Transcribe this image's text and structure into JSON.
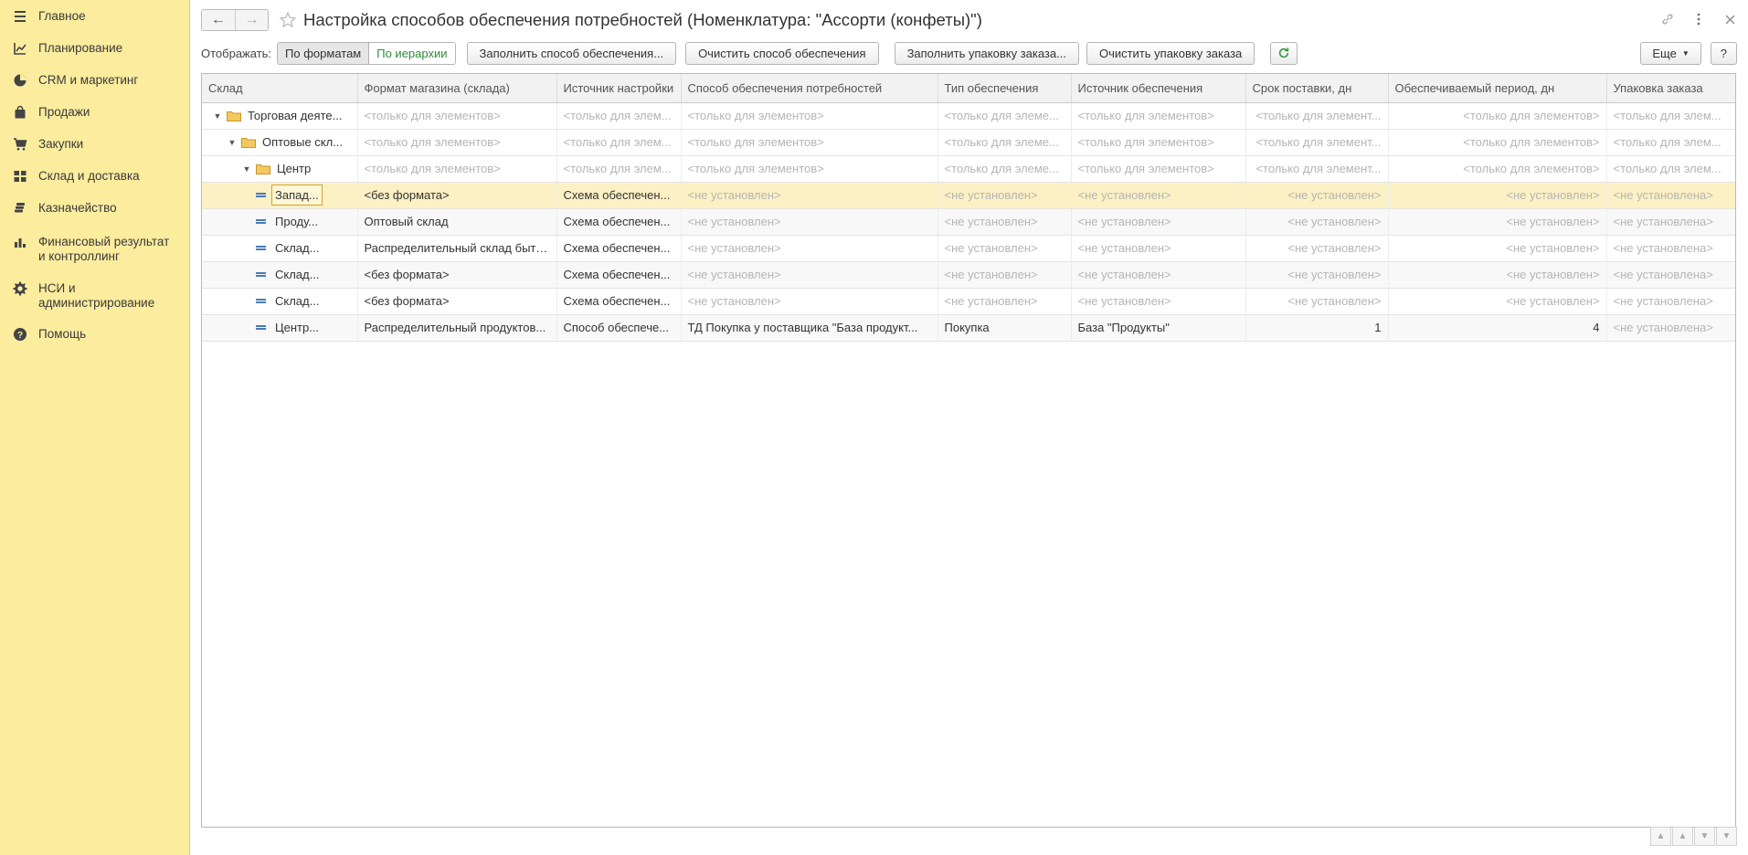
{
  "sidebar": {
    "items": [
      {
        "label": "Главное",
        "icon": "menu-icon"
      },
      {
        "label": "Планирование",
        "icon": "planning-icon"
      },
      {
        "label": "CRM и маркетинг",
        "icon": "pie-chart-icon"
      },
      {
        "label": "Продажи",
        "icon": "bag-icon"
      },
      {
        "label": "Закупки",
        "icon": "cart-icon"
      },
      {
        "label": "Склад и доставка",
        "icon": "warehouse-grid-icon"
      },
      {
        "label": "Казначейство",
        "icon": "coins-icon"
      },
      {
        "label": "Финансовый результат и контроллинг",
        "icon": "bar-chart-icon"
      },
      {
        "label": "НСИ и администрирование",
        "icon": "gear-icon"
      },
      {
        "label": "Помощь",
        "icon": "help-icon"
      }
    ]
  },
  "header": {
    "title": "Настройка способов обеспечения потребностей (Номенклатура: \"Ассорти (конфеты)\")"
  },
  "toolbar": {
    "display_label": "Отображать:",
    "by_formats": "По форматам",
    "by_hierarchy": "По иерархии",
    "fill_method": "Заполнить способ обеспечения...",
    "clear_method": "Очистить способ обеспечения",
    "fill_package": "Заполнить упаковку заказа...",
    "clear_package": "Очистить упаковку заказа",
    "more": "Еще",
    "help": "?"
  },
  "table": {
    "columns": [
      "Склад",
      "Формат магазина (склада)",
      "Источник настройки",
      "Способ обеспечения потребностей",
      "Тип обеспечения",
      "Источник обеспечения",
      "Срок поставки, дн",
      "Обеспечиваемый период, дн",
      "Упаковка заказа"
    ],
    "rows": [
      {
        "level": 0,
        "kind": "group",
        "cells": [
          "Торговая деяте...",
          "<только для элементов>",
          "<только для элем...",
          "<только для элементов>",
          "<только для элеме...",
          "<только для элементов>",
          "<только для элемент...",
          "<только для элементов>",
          "<только для элем..."
        ]
      },
      {
        "level": 1,
        "kind": "group",
        "cells": [
          "Оптовые скл...",
          "<только для элементов>",
          "<только для элем...",
          "<только для элементов>",
          "<только для элеме...",
          "<только для элементов>",
          "<только для элемент...",
          "<только для элементов>",
          "<только для элем..."
        ]
      },
      {
        "level": 2,
        "kind": "group",
        "cells": [
          "Центр",
          "<только для элементов>",
          "<только для элем...",
          "<только для элементов>",
          "<только для элеме...",
          "<только для элементов>",
          "<только для элемент...",
          "<только для элементов>",
          "<только для элем..."
        ]
      },
      {
        "level": 3,
        "kind": "item",
        "selected": true,
        "cells": [
          "Запад...",
          "<без формата>",
          "Схема обеспечен...",
          "<не установлен>",
          "<не установлен>",
          "<не установлен>",
          "<не установлен>",
          "<не установлен>",
          "<не установлена>"
        ]
      },
      {
        "level": 3,
        "kind": "item",
        "cells": [
          "Проду...",
          "Оптовый склад",
          "Схема обеспечен...",
          "<не установлен>",
          "<не установлен>",
          "<не установлен>",
          "<не установлен>",
          "<не установлен>",
          "<не установлена>"
        ]
      },
      {
        "level": 3,
        "kind": "item",
        "cells": [
          "Склад...",
          "Распределительный склад быто...",
          "Схема обеспечен...",
          "<не установлен>",
          "<не установлен>",
          "<не установлен>",
          "<не установлен>",
          "<не установлен>",
          "<не установлена>"
        ]
      },
      {
        "level": 3,
        "kind": "item",
        "cells": [
          "Склад...",
          "<без формата>",
          "Схема обеспечен...",
          "<не установлен>",
          "<не установлен>",
          "<не установлен>",
          "<не установлен>",
          "<не установлен>",
          "<не установлена>"
        ]
      },
      {
        "level": 3,
        "kind": "item",
        "cells": [
          "Склад...",
          "<без формата>",
          "Схема обеспечен...",
          "<не установлен>",
          "<не установлен>",
          "<не установлен>",
          "<не установлен>",
          "<не установлен>",
          "<не установлена>"
        ]
      },
      {
        "level": 3,
        "kind": "item",
        "cells": [
          "Центр...",
          "Распределительный продуктов...",
          "Способ обеспече...",
          "ТД Покупка у поставщика \"База продукт...",
          "Покупка",
          "База \"Продукты\"",
          "1",
          "4",
          "<не установлена>"
        ]
      }
    ]
  },
  "colors": {
    "sidebar_bg": "#fbec9e",
    "selected_row": "#fcf1c4",
    "accent_green": "#2e8b3a"
  }
}
